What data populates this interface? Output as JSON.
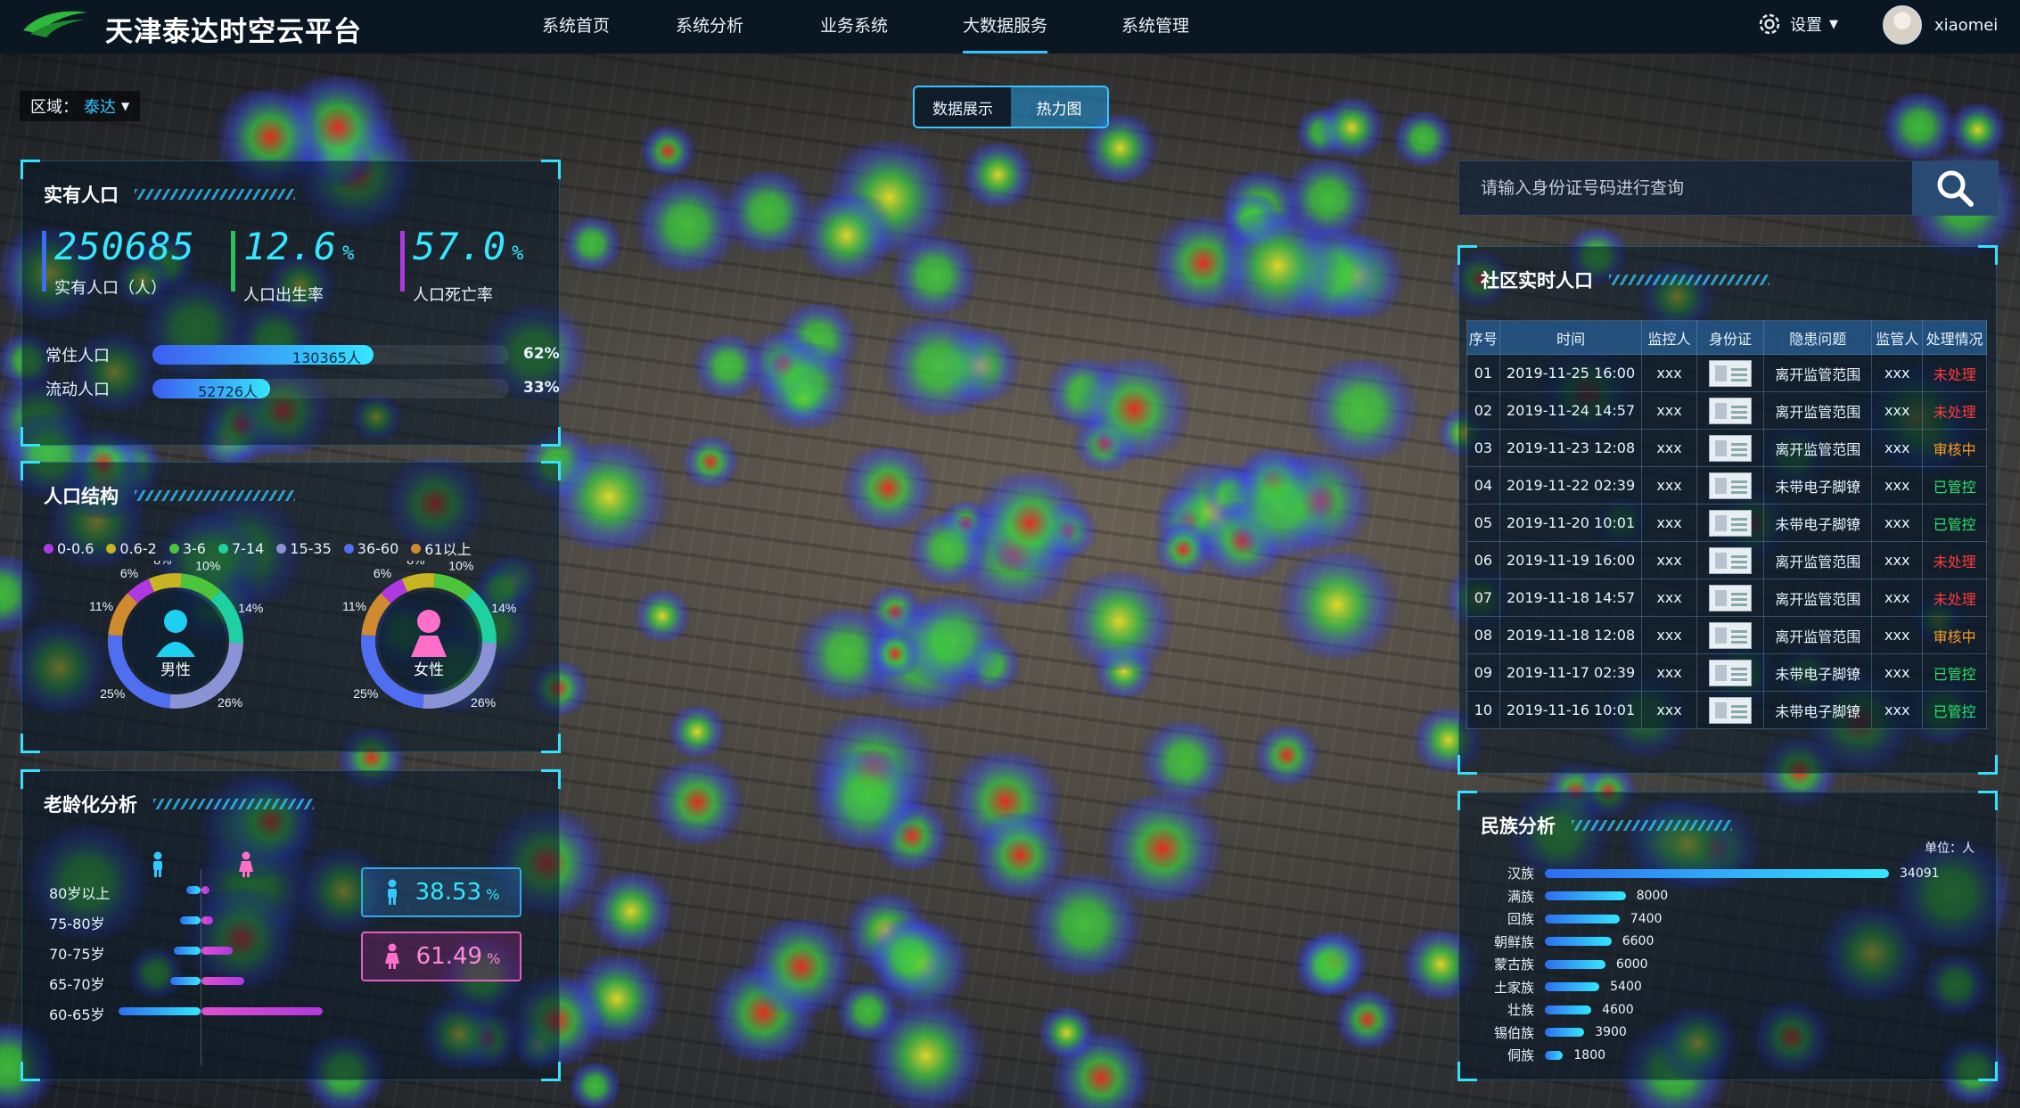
{
  "header": {
    "title": "天津泰达时空云平台",
    "nav": [
      "系统首页",
      "系统分析",
      "业务系统",
      "大数据服务",
      "系统管理"
    ],
    "active_nav": "大数据服务",
    "settings": "设置",
    "user": "xiaomei"
  },
  "region": {
    "label": "区域：",
    "value": "泰达"
  },
  "view_toggle": [
    "数据展示",
    "热力图"
  ],
  "population": {
    "title": "实有人口",
    "total": "250685",
    "total_label": "实有人口（人）",
    "birth_rate": "12.6",
    "birth_unit": "%",
    "birth_label": "人口出生率",
    "death_rate": "57.0",
    "death_unit": "%",
    "death_label": "人口死亡率",
    "resident": {
      "label": "常住人口",
      "value": "130365人",
      "pct": "62%",
      "fraction": 0.62
    },
    "floating": {
      "label": "流动人口",
      "value": "52726人",
      "pct": "33%",
      "fraction": 0.33
    }
  },
  "structure": {
    "title": "人口结构",
    "legend": [
      "0-0.6",
      "0.6-2",
      "3-6",
      "7-14",
      "15-35",
      "36-60",
      "61以上"
    ],
    "colors": [
      "#b038e0",
      "#c8b422",
      "#4cc43c",
      "#1fd0a0",
      "#8a93d6",
      "#4f6ef0",
      "#d08a30"
    ],
    "male": {
      "label": "男性",
      "segments": [
        6,
        8,
        10,
        14,
        26,
        25,
        11
      ]
    },
    "female": {
      "label": "女性",
      "segments": [
        6,
        8,
        10,
        14,
        26,
        25,
        11
      ]
    },
    "seg_labels": [
      "6%",
      "8%",
      "10%",
      "14%",
      "26%",
      "25%",
      "11%"
    ]
  },
  "aging": {
    "title": "老龄化分析",
    "rows": [
      {
        "label": "80岁以上",
        "male": 0.07,
        "female": 0.04
      },
      {
        "label": "75-80岁",
        "male": 0.1,
        "female": 0.06
      },
      {
        "label": "70-75岁",
        "male": 0.13,
        "female": 0.16
      },
      {
        "label": "65-70岁",
        "male": 0.15,
        "female": 0.22
      },
      {
        "label": "60-65岁",
        "male": 0.4,
        "female": 0.62
      }
    ],
    "male_pct": "38.53",
    "female_pct": "61.49",
    "unit": "%"
  },
  "search": {
    "placeholder": "请输入身份证号码进行查询"
  },
  "community": {
    "title": "社区实时人口",
    "columns": [
      "序号",
      "时间",
      "监控人",
      "身份证",
      "隐患问题",
      "监管人",
      "处理情况"
    ],
    "rows": [
      [
        "01",
        "2019-11-25 16:00",
        "xxx",
        "",
        "离开监管范围",
        "xxx",
        "未处理"
      ],
      [
        "02",
        "2019-11-24 14:57",
        "xxx",
        "",
        "离开监管范围",
        "xxx",
        "未处理"
      ],
      [
        "03",
        "2019-11-23 12:08",
        "xxx",
        "",
        "离开监管范围",
        "xxx",
        "审核中"
      ],
      [
        "04",
        "2019-11-22 02:39",
        "xxx",
        "",
        "未带电子脚镣",
        "xxx",
        "已管控"
      ],
      [
        "05",
        "2019-11-20 10:01",
        "xxx",
        "",
        "未带电子脚镣",
        "xxx",
        "已管控"
      ],
      [
        "06",
        "2019-11-19 16:00",
        "xxx",
        "",
        "离开监管范围",
        "xxx",
        "未处理"
      ],
      [
        "07",
        "2019-11-18 14:57",
        "xxx",
        "",
        "离开监管范围",
        "xxx",
        "未处理"
      ],
      [
        "08",
        "2019-11-18 12:08",
        "xxx",
        "",
        "离开监管范围",
        "xxx",
        "审核中"
      ],
      [
        "09",
        "2019-11-17 02:39",
        "xxx",
        "",
        "未带电子脚镣",
        "xxx",
        "已管控"
      ],
      [
        "10",
        "2019-11-16 10:01",
        "xxx",
        "",
        "未带电子脚镣",
        "xxx",
        "已管控"
      ]
    ],
    "status_colors": {
      "未处理": "#ff3b3b",
      "审核中": "#ff9a1f",
      "已管控": "#2ee06b"
    }
  },
  "ethnic": {
    "title": "民族分析",
    "unit": "单位：人",
    "rows": [
      {
        "label": "汉族",
        "value": 34091
      },
      {
        "label": "满族",
        "value": 8000
      },
      {
        "label": "回族",
        "value": 7400
      },
      {
        "label": "朝鲜族",
        "value": 6600
      },
      {
        "label": "蒙古族",
        "value": 6000
      },
      {
        "label": "土家族",
        "value": 5400
      },
      {
        "label": "壮族",
        "value": 4600
      },
      {
        "label": "锡伯族",
        "value": 3900
      },
      {
        "label": "侗族",
        "value": 1800
      }
    ]
  }
}
